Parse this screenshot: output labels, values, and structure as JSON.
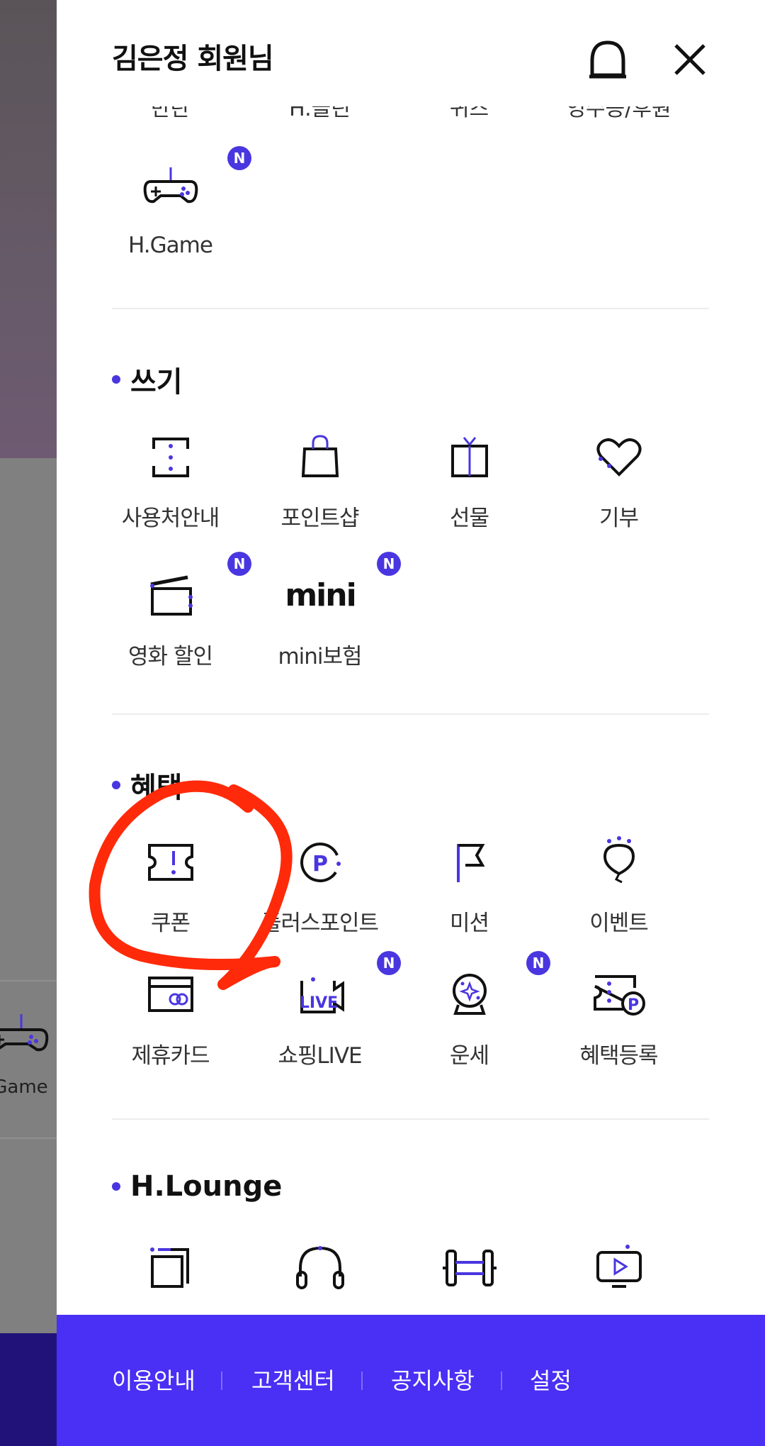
{
  "header": {
    "user_name": "김은정 회원님"
  },
  "cut_labels": [
    "반탄",
    "H.클린",
    "퀴즈",
    "영수증/후원"
  ],
  "top_items": [
    {
      "label": "H.Game",
      "icon": "gamepad-icon",
      "badge": "N"
    }
  ],
  "sections": {
    "use": {
      "title": "쓰기",
      "items": [
        {
          "label": "사용처안내",
          "icon": "map-pin-icon"
        },
        {
          "label": "포인트샵",
          "icon": "shopping-bag-icon"
        },
        {
          "label": "선물",
          "icon": "gift-icon"
        },
        {
          "label": "기부",
          "icon": "heart-icon"
        },
        {
          "label": "영화 할인",
          "icon": "clapperboard-icon",
          "badge": "N"
        },
        {
          "label": "mini보험",
          "icon": "mini-logo-icon",
          "badge": "N",
          "icon_text": "mini"
        }
      ]
    },
    "benefit": {
      "title": "혜택",
      "items": [
        {
          "label": "쿠폰",
          "icon": "coupon-ticket-icon"
        },
        {
          "label": "플러스포인트",
          "icon": "plus-point-icon",
          "icon_text": "P"
        },
        {
          "label": "미션",
          "icon": "flag-icon"
        },
        {
          "label": "이벤트",
          "icon": "balloon-icon"
        },
        {
          "label": "제휴카드",
          "icon": "credit-card-icon"
        },
        {
          "label": "쇼핑LIVE",
          "icon": "live-camera-icon",
          "badge": "N",
          "icon_text": "LIVE"
        },
        {
          "label": "운세",
          "icon": "crystal-ball-icon",
          "badge": "N"
        },
        {
          "label": "혜택등록",
          "icon": "benefit-register-icon",
          "icon_text": "P"
        }
      ]
    },
    "lounge": {
      "title": "H.Lounge",
      "items": [
        {
          "icon": "layers-icon"
        },
        {
          "icon": "headphones-icon"
        },
        {
          "icon": "dumbbell-icon"
        },
        {
          "icon": "play-screen-icon"
        }
      ]
    }
  },
  "footer": {
    "links": [
      "이용안내",
      "고객센터",
      "공지사항",
      "설정"
    ]
  },
  "background": {
    "game_label": ".Game"
  },
  "colors": {
    "accent": "#4a36e0",
    "footer": "#4a2ff5",
    "annotation": "#ff2a0a"
  }
}
